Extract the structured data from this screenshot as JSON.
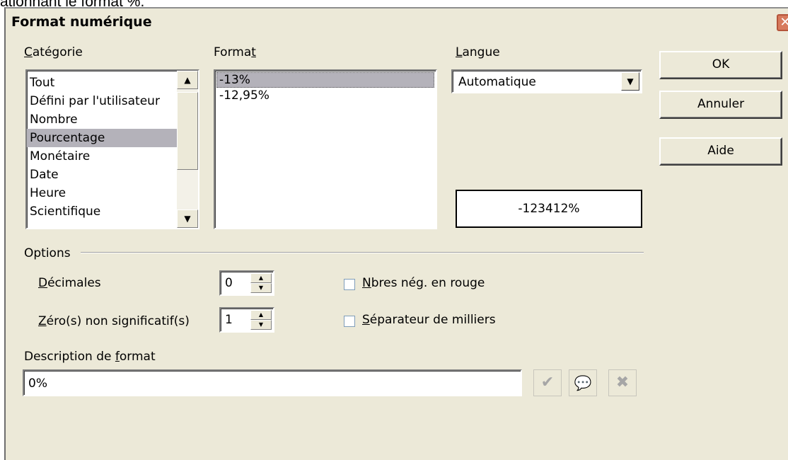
{
  "above_text": "ationnant le format %.",
  "dialog": {
    "title": "Format numérique",
    "close_icon": "close-icon"
  },
  "category": {
    "label_u": "C",
    "label_rest": "atégorie",
    "items": [
      "Tout",
      "Défini par l'utilisateur",
      "Nombre",
      "Pourcentage",
      "Monétaire",
      "Date",
      "Heure",
      "Scientifique"
    ],
    "selected": "Pourcentage"
  },
  "format": {
    "label_pre": "Forma",
    "label_u": "t",
    "items": [
      "-13%",
      "-12,95%"
    ],
    "selected": "-13%"
  },
  "language": {
    "label_u": "L",
    "label_rest": "angue",
    "value": "Automatique"
  },
  "preview": {
    "value": "-123412%"
  },
  "buttons": {
    "ok": "OK",
    "cancel": "Annuler",
    "help": "Aide"
  },
  "options": {
    "label": "Options",
    "decimals_label_u": "D",
    "decimals_label_rest": "écimales",
    "decimals_value": "0",
    "zeros_label_u": "Z",
    "zeros_label_rest": "éro(s) non significatif(s)",
    "zeros_value": "1",
    "neg_red_label_u": "N",
    "neg_red_label_rest": "bres nég. en rouge",
    "neg_red_checked": false,
    "thousands_label_u": "S",
    "thousands_label_rest": "éparateur de milliers",
    "thousands_checked": false
  },
  "format_code": {
    "label_pre": "Description de ",
    "label_u": "f",
    "label_rest": "ormat",
    "value": "0%"
  },
  "action_icons": [
    "checkmark-icon",
    "comment-icon",
    "delete-icon"
  ]
}
